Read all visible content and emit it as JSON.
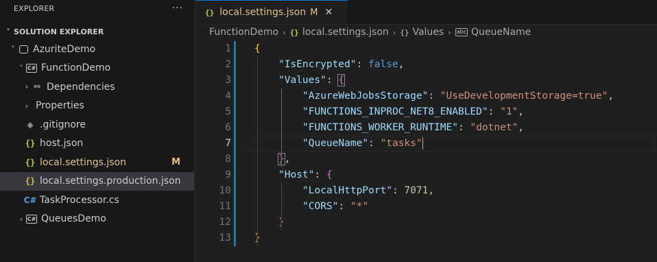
{
  "sidebar": {
    "header_title": "EXPLORER",
    "more_actions": "···",
    "section_title": "SOLUTION EXPLORER",
    "items": [
      {
        "label": "AzuriteDemo",
        "icon": "solution-icon",
        "twist": "˅",
        "depth": 1
      },
      {
        "label": "FunctionDemo",
        "icon": "csproj-icon",
        "icon_text": "C#",
        "twist": "˅",
        "depth": 2
      },
      {
        "label": "Dependencies",
        "icon": "dependencies-icon",
        "twist": "›",
        "depth": 3
      },
      {
        "label": "Properties",
        "icon": "",
        "twist": "›",
        "depth": 3
      },
      {
        "label": ".gitignore",
        "icon": "git-icon",
        "depth": 3
      },
      {
        "label": "host.json",
        "icon": "json-icon",
        "icon_text": "{}",
        "depth": 3
      },
      {
        "label": "local.settings.json",
        "icon": "json-icon",
        "icon_text": "{}",
        "depth": 3,
        "badge": "M",
        "modified": true
      },
      {
        "label": "local.settings.production.json",
        "icon": "json-icon",
        "icon_text": "{}",
        "depth": 3,
        "selected": true
      },
      {
        "label": "TaskProcessor.cs",
        "icon": "csharp-icon",
        "icon_text": "C#",
        "depth": 3
      },
      {
        "label": "QueuesDemo",
        "icon": "csproj-icon",
        "icon_text": "C#",
        "twist": "›",
        "depth": 2
      }
    ]
  },
  "tab": {
    "icon_text": "{}",
    "label": "local.settings.json",
    "modified_badge": "M",
    "close_glyph": "✕"
  },
  "breadcrumb": {
    "items": [
      "FunctionDemo",
      "local.settings.json",
      "Values",
      "QueueName"
    ],
    "json_icon_text": "{}",
    "object_icon_text": "{}",
    "string_icon_text": "abc"
  },
  "editor": {
    "current_line": 7,
    "line_numbers": [
      "1",
      "2",
      "3",
      "4",
      "5",
      "6",
      "7",
      "8",
      "9",
      "10",
      "11",
      "12",
      "13"
    ],
    "lines": [
      "{",
      "\"IsEncrypted\": false,",
      "\"Values\": {",
      "\"AzureWebJobsStorage\": \"UseDevelopmentStorage=true\",",
      "\"FUNCTIONS_INPROC_NET8_ENABLED\": \"1\",",
      "\"FUNCTIONS_WORKER_RUNTIME\": \"dotnet\",",
      "\"QueueName\": \"tasks\"",
      "},",
      "\"Host\": {",
      "\"LocalHttpPort\": 7071,",
      "\"CORS\": \"*\"",
      "}",
      "}"
    ],
    "tokens": [
      [
        [
          "{",
          "t-b1"
        ]
      ],
      [
        [
          "\"IsEncrypted\"",
          "t-key"
        ],
        [
          ": ",
          "t-punc"
        ],
        [
          "false",
          "t-kw"
        ],
        [
          ",",
          "t-punc"
        ]
      ],
      [
        [
          "\"Values\"",
          "t-key"
        ],
        [
          ": ",
          "t-punc"
        ],
        [
          "{",
          "t-b2 bracket-hl"
        ]
      ],
      [
        [
          "\"AzureWebJobsStorage\"",
          "t-key"
        ],
        [
          ": ",
          "t-punc"
        ],
        [
          "\"UseDevelopmentStorage=true\"",
          "t-str"
        ],
        [
          ",",
          "t-punc"
        ]
      ],
      [
        [
          "\"FUNCTIONS_INPROC_NET8_ENABLED\"",
          "t-key"
        ],
        [
          ": ",
          "t-punc"
        ],
        [
          "\"1\"",
          "t-str"
        ],
        [
          ",",
          "t-punc"
        ]
      ],
      [
        [
          "\"FUNCTIONS_WORKER_RUNTIME\"",
          "t-key"
        ],
        [
          ": ",
          "t-punc"
        ],
        [
          "\"dotnet\"",
          "t-str"
        ],
        [
          ",",
          "t-punc"
        ]
      ],
      [
        [
          "\"QueueName\"",
          "t-key"
        ],
        [
          ": ",
          "t-punc"
        ],
        [
          "\"tasks\"",
          "t-str"
        ],
        [
          "|caret",
          ""
        ]
      ],
      [
        [
          "}",
          "t-b2 bracket-hl"
        ],
        [
          ",",
          "t-punc"
        ]
      ],
      [
        [
          "\"Host\"",
          "t-key"
        ],
        [
          ": ",
          "t-punc"
        ],
        [
          "{",
          "t-b2"
        ]
      ],
      [
        [
          "\"LocalHttpPort\"",
          "t-key"
        ],
        [
          ": ",
          "t-punc"
        ],
        [
          "7071",
          "t-num"
        ],
        [
          ",",
          "t-punc"
        ]
      ],
      [
        [
          "\"CORS\"",
          "t-key"
        ],
        [
          ": ",
          "t-punc"
        ],
        [
          "\"*\"",
          "t-str"
        ]
      ],
      [
        [
          "}",
          "t-b2"
        ]
      ],
      [
        [
          "}",
          "t-b1"
        ]
      ]
    ],
    "indent": [
      0,
      1,
      1,
      2,
      2,
      2,
      2,
      1,
      1,
      2,
      2,
      1,
      0
    ]
  },
  "colors": {
    "accent": "#0078d4",
    "modified": "#e2c08d",
    "json_icon": "#cbcb41",
    "csharp_icon": "#4f9ee9"
  }
}
